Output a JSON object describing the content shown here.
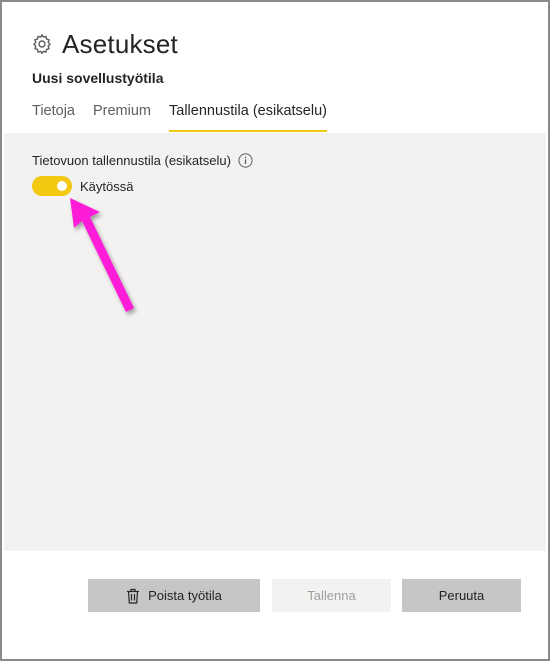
{
  "dialog": {
    "title": "Asetukset",
    "subtitle": "Uusi sovellustyötila"
  },
  "tabs": [
    {
      "label": "Tietoja",
      "active": false
    },
    {
      "label": "Premium",
      "active": false
    },
    {
      "label": "Tallennustila (esikatselu)",
      "active": true
    }
  ],
  "storage": {
    "setting_label": "Tietovuon tallennustila (esikatselu)",
    "toggle_state": "Käytössä",
    "toggle_on": true
  },
  "footer": {
    "delete_label": "Poista työtila",
    "save_label": "Tallenna",
    "cancel_label": "Peruuta"
  },
  "colors": {
    "accent": "#f2c811",
    "annotation_arrow": "#ff1ad9",
    "content_bg": "#f3f2f1",
    "button_bg": "#c8c6c4"
  },
  "icons": {
    "title": "gear-icon",
    "info": "info-icon",
    "delete": "trash-icon"
  }
}
